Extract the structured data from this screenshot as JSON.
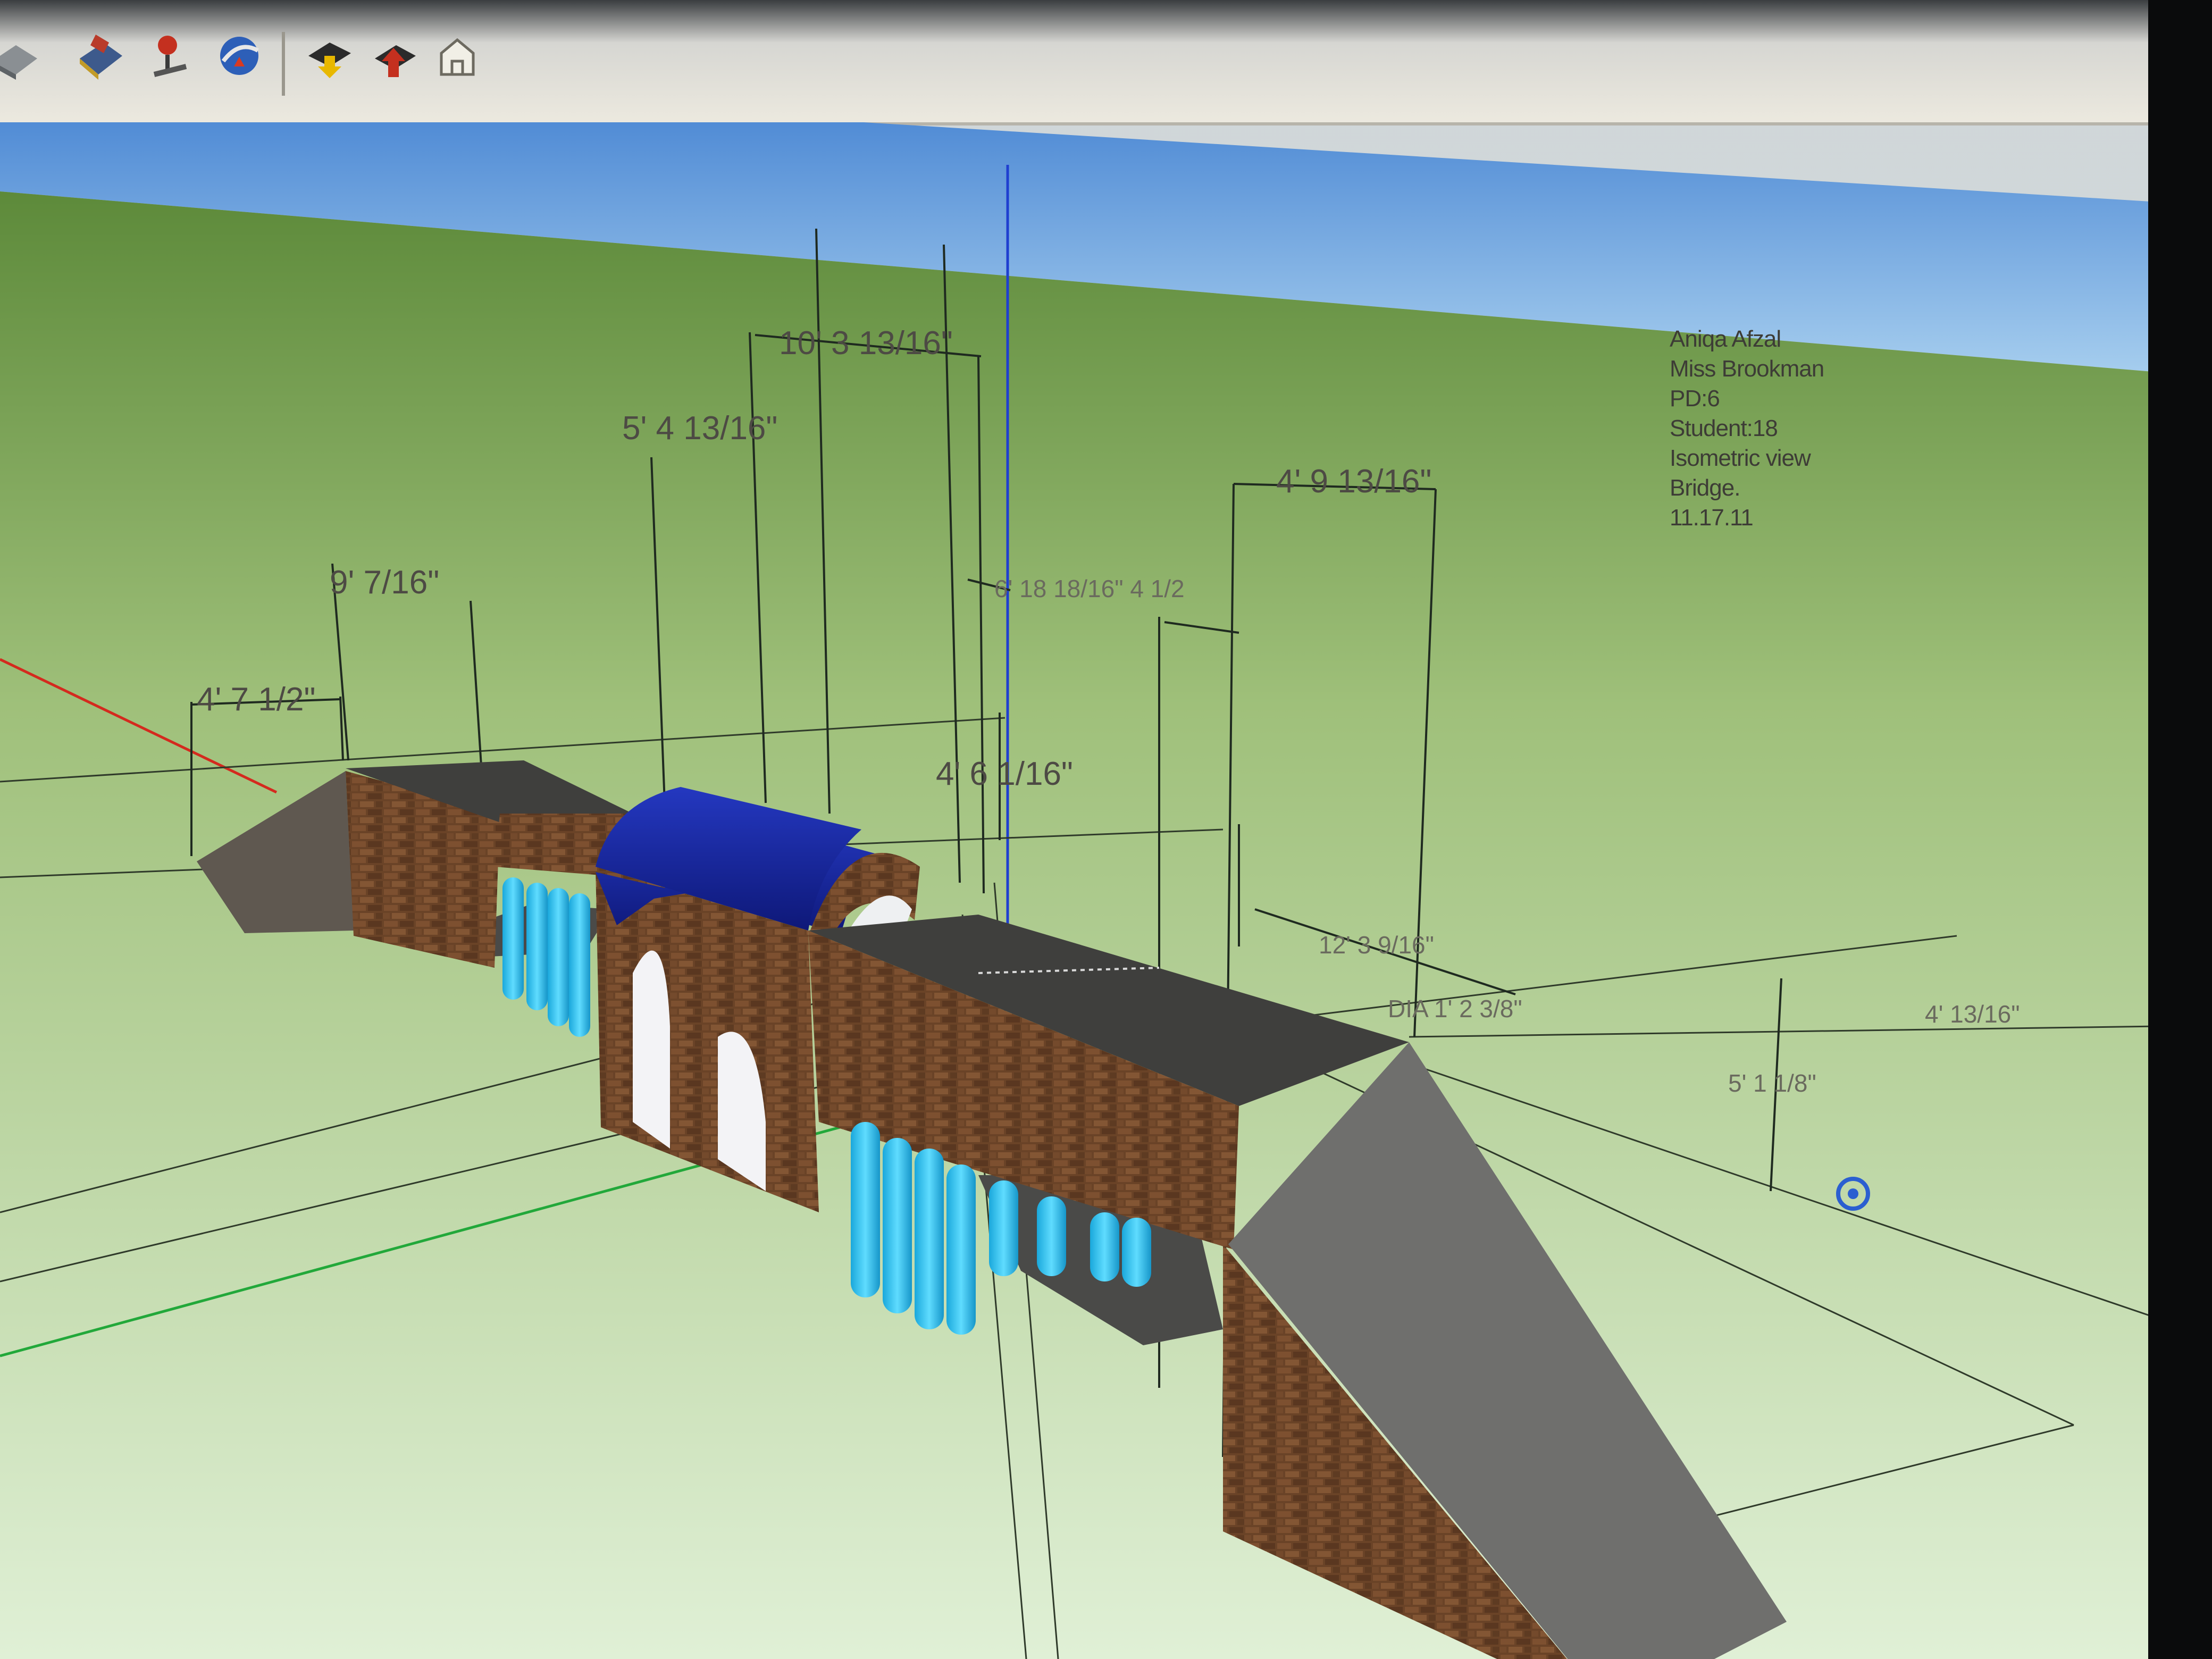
{
  "colors": {
    "ground_top": "#6f9a44",
    "ground_bottom": "#e2f1d8",
    "sky": "#7fb8e8",
    "deck": "#3f3f3d",
    "brick": "#5b3a22",
    "canopy": "#16249a",
    "columns": "#27c3f2",
    "red_axis": "#d42a1e",
    "green_axis": "#22a83a",
    "blue_axis": "#1f3fd0"
  },
  "toolbar": {
    "buttons": [
      {
        "name": "get-models-icon",
        "label": "Get Models"
      },
      {
        "name": "components-icon",
        "label": "Components"
      },
      {
        "name": "add-location-icon",
        "label": "Add Location"
      },
      {
        "name": "google-earth-icon",
        "label": "Google Earth"
      },
      {
        "name": "upload-model-icon",
        "label": "Share Model"
      },
      {
        "name": "download-model-icon",
        "label": "Get Models"
      },
      {
        "name": "warehouse-icon",
        "label": "3D Warehouse"
      }
    ]
  },
  "dimensions": {
    "d1": "4' 7 1/2\"",
    "d2": "9' 7/16\"",
    "d3": "5' 4 13/16\"",
    "d4": "10' 3 13/16\"",
    "d5": "4' 9 13/16\"",
    "d6": "6' 18 18/16\" 4 1/2",
    "d7": "4' 6 1/16\"",
    "d8": "12' 3 9/16\"",
    "d9": "DIA 1' 2 3/8\"",
    "d10": "5' 1 1/8\"",
    "d11": "4' 13/16\""
  },
  "info": {
    "line1": "Aniqa Afzal",
    "line2": "Miss Brookman",
    "line3": "PD:6",
    "line4": "Student:18",
    "line5": "Isometric view",
    "line6": "Bridge.",
    "line7": "11.17.11"
  }
}
